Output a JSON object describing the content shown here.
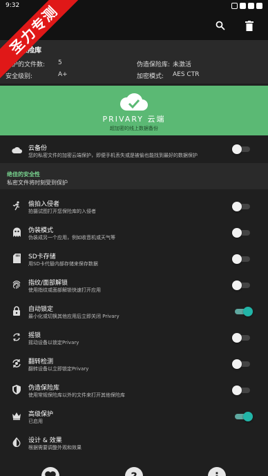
{
  "status": {
    "time": "9:32"
  },
  "ribbon": {
    "text": "圣力专测"
  },
  "appbar": {
    "search_icon": "search-icon",
    "delete_icon": "trash-icon"
  },
  "info": {
    "title": "保险库",
    "protected_label": "保护的文件数:",
    "protected_value": "5",
    "decoy_label": "伪造保险库:",
    "decoy_value": "未激活",
    "security_label": "安全级别:",
    "security_value": "A+",
    "encryption_label": "加密模式:",
    "encryption_value": "AES CTR"
  },
  "banner": {
    "name": "PRIVARY 云端",
    "subtitle": "超加密的线上数据备份",
    "color": "#5bb974"
  },
  "cloud_backup": {
    "title": "云备份",
    "subtitle": "您的私密文件的加密云端保护，即便手机丢失或是被偷也能找到最好的数据保护"
  },
  "section": {
    "heading": "绝佳的安全性",
    "subheading": "私密文件将时刻受到保护"
  },
  "items": [
    {
      "title": "偷拍入侵者",
      "subtitle": "拍摄试图打开您保险库的入侵者",
      "icon": "running-man-icon",
      "on": false
    },
    {
      "title": "伪装模式",
      "subtitle": "伪装成另一个应用，例如收音机或天气等",
      "icon": "ghost-icon",
      "on": false
    },
    {
      "title": "SD卡存储",
      "subtitle": "用SD卡代替内部存储来保存数据",
      "icon": "sd-card-icon",
      "on": false
    },
    {
      "title": "指纹/面部解锁",
      "subtitle": "使用指纹或面部解锁快速打开应用",
      "icon": "fingerprint-icon",
      "on": false
    },
    {
      "title": "自动锁定",
      "subtitle": "最小化或切换其他应用后立即关闭 Privary",
      "icon": "lock-icon",
      "on": true
    },
    {
      "title": "摇锁",
      "subtitle": "摇动设备以锁定Privary",
      "icon": "shake-icon",
      "on": false
    },
    {
      "title": "翻转检测",
      "subtitle": "翻转设备以立即锁定Privary",
      "icon": "flip-icon",
      "on": false
    },
    {
      "title": "伪造保险库",
      "subtitle": "使用常规保险库以外的文件来打开其他保险库",
      "icon": "shield-icon",
      "on": false
    },
    {
      "title": "高级保护",
      "subtitle": "已启用",
      "icon": "crown-icon",
      "on": true
    },
    {
      "title": "设计 & 效果",
      "subtitle": "根据需要调整外观和效果",
      "icon": "contrast-icon",
      "on": null
    }
  ],
  "bottom": {
    "help": "?",
    "more": "⋮"
  }
}
